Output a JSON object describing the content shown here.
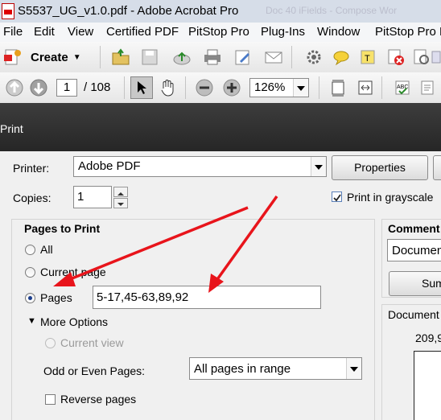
{
  "window": {
    "title": "S5537_UG_v1.0.pdf - Adobe Acrobat Pro",
    "background_tabs_text": "Doc 40   iFields - Compose Wor"
  },
  "menu": [
    "File",
    "Edit",
    "View",
    "Certified PDF",
    "PitStop Pro",
    "Plug-Ins",
    "Window",
    "PitStop Pro D"
  ],
  "toolbar": {
    "create_label": "Create",
    "page_current": "1",
    "page_total": "/ 108",
    "zoom": "126%"
  },
  "dialog": {
    "title": "Print",
    "printer_label": "Printer:",
    "printer_value": "Adobe PDF",
    "properties_label": "Properties",
    "copies_label": "Copies:",
    "copies_value": "1",
    "grayscale_label": "Print in grayscale",
    "pages_to_print": {
      "heading": "Pages to Print",
      "all": "All",
      "current_page": "Current page",
      "pages": "Pages",
      "pages_value": "5-17,45-63,89,92",
      "more_options": "More Options",
      "current_view": "Current view",
      "odd_even_label": "Odd or Even Pages:",
      "odd_even_value": "All pages in range",
      "reverse_pages": "Reverse pages"
    },
    "comments": {
      "heading": "Comment",
      "value": "Documen",
      "summarize_label": "Sum",
      "document_label": "Document",
      "document_size": "209,9"
    }
  },
  "colors": {
    "annotation_arrow": "#e8141b",
    "dialog_header": "#333333"
  }
}
